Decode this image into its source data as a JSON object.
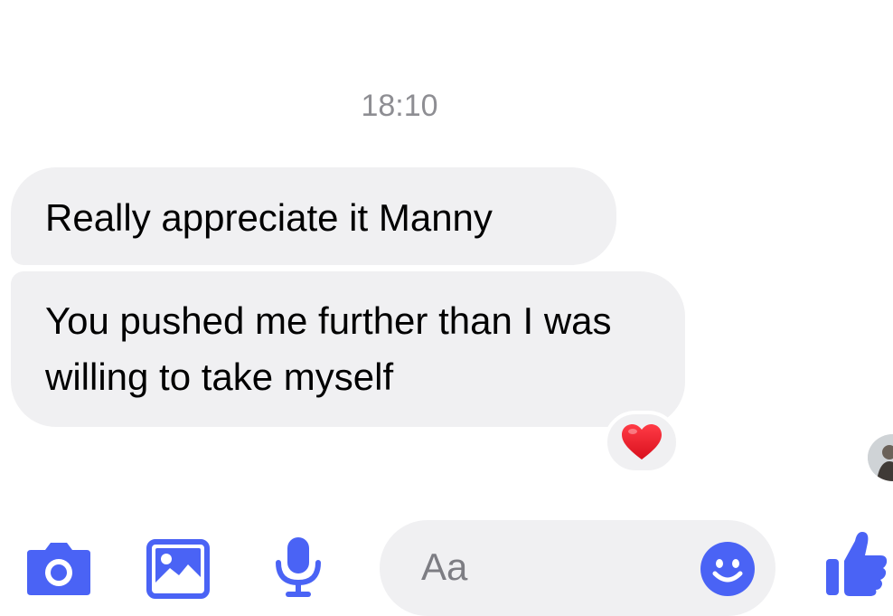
{
  "conversation": {
    "timestamp": "18:10",
    "messages": [
      {
        "text": "Really appreciate it Manny"
      },
      {
        "text": "You pushed me further than I was willing to take myself",
        "reaction": "heart"
      }
    ]
  },
  "composer": {
    "placeholder": "Aa",
    "icons": [
      "camera-icon",
      "image-icon",
      "microphone-icon",
      "emoji-icon",
      "thumbs-up-icon"
    ],
    "accent_color": "#4a63f5"
  },
  "colors": {
    "bubble_bg": "#f0f0f2",
    "heart": "#e8202d",
    "timestamp": "#8e8e93"
  }
}
